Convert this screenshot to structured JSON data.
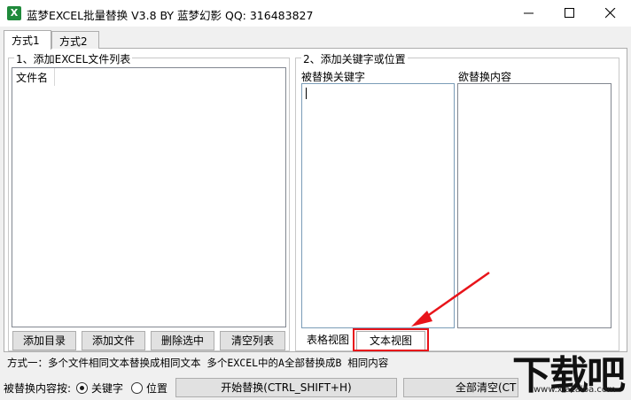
{
  "window": {
    "title": "蓝梦EXCEL批量替换 V3.8 BY 蓝梦幻影 QQ: 316483827",
    "icon": "excel-icon"
  },
  "tabs": [
    {
      "label": "方式1",
      "active": true
    },
    {
      "label": "方式2",
      "active": false
    }
  ],
  "file_group": {
    "label": "1、添加EXCEL文件列表",
    "column_header": "文件名",
    "buttons": {
      "add_dir": "添加目录",
      "add_file": "添加文件",
      "delete_selected": "删除选中",
      "clear_list": "清空列表"
    }
  },
  "keyword_group": {
    "label": "2、添加关键字或位置",
    "replaced_label": "被替换关键字",
    "replacement_label": "欲替换内容",
    "replaced_value": "",
    "replacement_value": "",
    "view_buttons": {
      "table_view": "表格视图",
      "text_view": "文本视图"
    }
  },
  "status_text": "方式一：多个文件相同文本替换成相同文本  多个EXCEL中的A全部替换成B 相同内容",
  "bottom": {
    "replace_by_label": "被替换内容按:",
    "options": [
      {
        "label": "关键字",
        "selected": true
      },
      {
        "label": "位置",
        "selected": false
      }
    ],
    "start_button": "开始替换(CTRL_SHIFT+H)",
    "clear_all_button": "全部清空(CT"
  },
  "watermark": {
    "text": "下载吧",
    "url": "www.xiazaiba.com"
  },
  "colors": {
    "highlight": "#e8141a",
    "arrow": "#e8141a"
  }
}
